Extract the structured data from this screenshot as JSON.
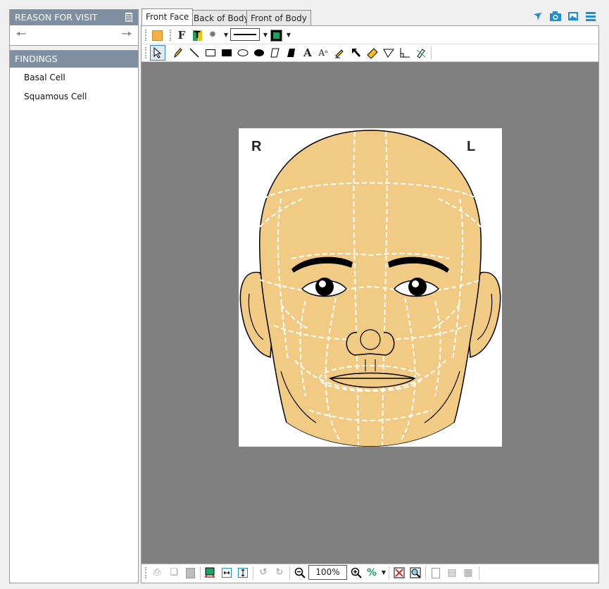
{
  "left_panel": {
    "reason_header": "REASON FOR VISIT",
    "findings_header": "FINDINGS",
    "findings": [
      "Basal Cell",
      "Squamous Cell"
    ]
  },
  "tabs": [
    {
      "label": "Front Face",
      "active": true
    },
    {
      "label": "Back of Body",
      "active": false
    },
    {
      "label": "Front of Body",
      "active": false
    }
  ],
  "diagram": {
    "right_marker": "R",
    "left_marker": "L"
  },
  "zoom": {
    "value": "100%"
  },
  "colors": {
    "header": "#7d8fa0",
    "canvas_bg": "#808080",
    "skin": "#f1cb84",
    "accent_blue": "#1a8fd8"
  }
}
